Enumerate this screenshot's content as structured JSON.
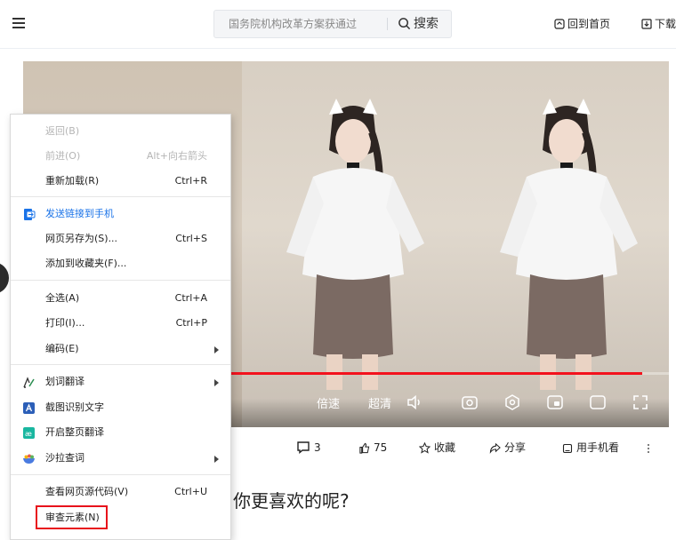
{
  "header": {
    "menu_icon": "hamburger-icon",
    "search_placeholder": "国务院机构改革方案获通过",
    "search_button": "搜索",
    "home_link": "回到首页",
    "download_link": "下载"
  },
  "video": {
    "speed_label": "倍速",
    "quality_label": "超清",
    "progress": 0.94,
    "icons": [
      "volume-icon",
      "screenshot-icon",
      "settings-icon",
      "picture-in-picture-icon",
      "web-fullscreen-icon",
      "fullscreen-icon"
    ]
  },
  "actions": {
    "comments": "3",
    "likes": "75",
    "favorite": "收藏",
    "share": "分享",
    "mobile": "用手机看",
    "more_icon": "more-vertical-icon"
  },
  "headline_visible": "你更喜欢的呢?",
  "context_menu": {
    "back": {
      "label": "返回(B)",
      "shortcut": ""
    },
    "forward": {
      "label": "前进(O)",
      "shortcut": "Alt+向右箭头"
    },
    "reload": {
      "label": "重新加载(R)",
      "shortcut": "Ctrl+R"
    },
    "send_to_phone": {
      "label": "发送链接到手机"
    },
    "save_as": {
      "label": "网页另存为(S)...",
      "shortcut": "Ctrl+S"
    },
    "add_favorites": {
      "label": "添加到收藏夹(F)..."
    },
    "select_all": {
      "label": "全选(A)",
      "shortcut": "Ctrl+A"
    },
    "print": {
      "label": "打印(I)...",
      "shortcut": "Ctrl+P"
    },
    "encoding": {
      "label": "编码(E)"
    },
    "translate_word": {
      "label": "划词翻译"
    },
    "ocr": {
      "label": "截图识别文字"
    },
    "translate_page": {
      "label": "开启整页翻译"
    },
    "salad": {
      "label": "沙拉查词"
    },
    "view_source": {
      "label": "查看网页源代码(V)",
      "shortcut": "Ctrl+U"
    },
    "inspect": {
      "label": "审查元素(N)"
    }
  },
  "colors": {
    "accent_red": "#f3121d",
    "link_blue": "#1a73e8",
    "highlight_red": "#e8121b"
  }
}
